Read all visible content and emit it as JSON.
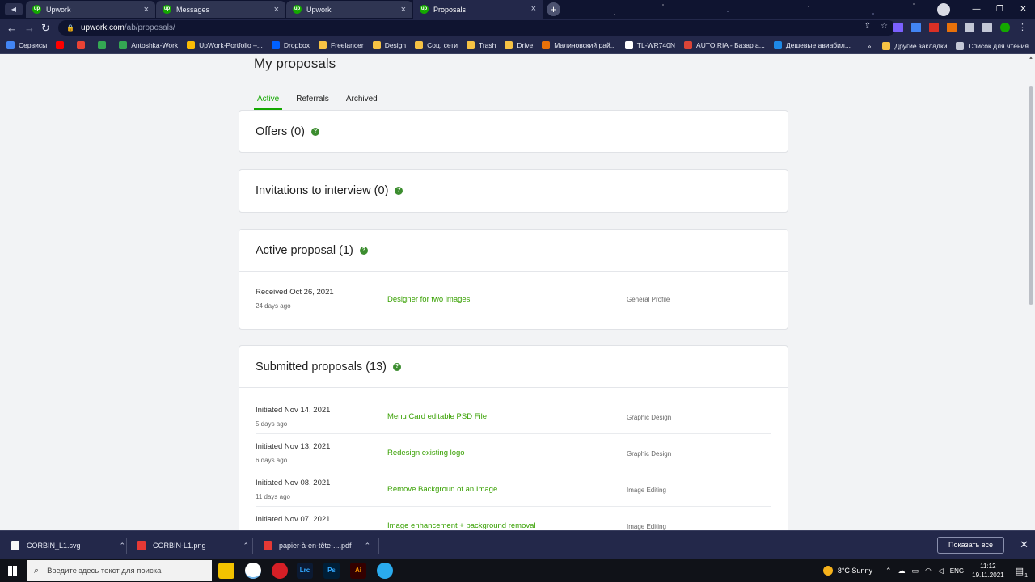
{
  "browser": {
    "tabs": [
      {
        "title": "Upwork",
        "active": false
      },
      {
        "title": "Messages",
        "active": false
      },
      {
        "title": "Upwork",
        "active": false
      },
      {
        "title": "Proposals",
        "active": true
      }
    ],
    "url_host": "upwork.com",
    "url_path": "/ab/proposals/",
    "bookmarks": [
      {
        "label": "Сервисы",
        "color": "#4285f4"
      },
      {
        "label": "",
        "color": "#ff0000"
      },
      {
        "label": "",
        "color": "#ea4335"
      },
      {
        "label": "",
        "color": "#34a853"
      },
      {
        "label": "Antoshka-Work",
        "color": "#34a853"
      },
      {
        "label": "UpWork-Portfolio –...",
        "color": "#fbbc04"
      },
      {
        "label": "Dropbox",
        "color": "#0061ff"
      },
      {
        "label": "Freelancer",
        "color": "#f6c244"
      },
      {
        "label": "Design",
        "color": "#f6c244"
      },
      {
        "label": "Соц. сети",
        "color": "#f6c244"
      },
      {
        "label": "Trash",
        "color": "#f6c244"
      },
      {
        "label": "Drive",
        "color": "#f6c244"
      },
      {
        "label": "Малиновский рай...",
        "color": "#e8710a"
      },
      {
        "label": "TL-WR740N",
        "color": "#ffffff"
      },
      {
        "label": "AUTO.RIA - Базар а...",
        "color": "#db4437"
      },
      {
        "label": "Дешевые авиабил...",
        "color": "#1e88e5"
      }
    ],
    "bookmarks_more": "»",
    "other_bookmarks": "Другие закладки",
    "reading_list": "Список для чтения"
  },
  "page": {
    "title": "My proposals",
    "subtabs": [
      {
        "label": "Active",
        "active": true
      },
      {
        "label": "Referrals",
        "active": false
      },
      {
        "label": "Archived",
        "active": false
      }
    ],
    "sections": {
      "offers": {
        "title": "Offers (0)"
      },
      "invitations": {
        "title": "Invitations to interview (0)"
      },
      "active": {
        "title": "Active proposal (1)",
        "rows": [
          {
            "date": "Received Oct 26, 2021",
            "ago": "24 days ago",
            "job": "Designer for two images",
            "profile": "General Profile"
          }
        ]
      },
      "submitted": {
        "title": "Submitted proposals (13)",
        "rows": [
          {
            "date": "Initiated Nov 14, 2021",
            "ago": "5 days ago",
            "job": "Menu Card editable PSD File",
            "profile": "Graphic Design"
          },
          {
            "date": "Initiated Nov 13, 2021",
            "ago": "6 days ago",
            "job": "Redesign existing logo",
            "profile": "Graphic Design"
          },
          {
            "date": "Initiated Nov 08, 2021",
            "ago": "11 days ago",
            "job": "Remove Backgroun of an Image",
            "profile": "Image Editing"
          },
          {
            "date": "Initiated Nov 07, 2021",
            "ago": "",
            "job": "Image enhancement + background removal",
            "profile": "Image Editing"
          }
        ]
      }
    }
  },
  "downloads": {
    "items": [
      {
        "name": "CORBIN_L1.svg",
        "color": "#f5f5f5"
      },
      {
        "name": "CORBIN-L1.png",
        "color": "#e53935"
      },
      {
        "name": "papier-à-en-tête-....pdf",
        "color": "#e53935"
      }
    ],
    "show_all": "Показать все"
  },
  "taskbar": {
    "search_placeholder": "Введите здесь текст для поиска",
    "apps": [
      {
        "label": "",
        "color": "#f2c200",
        "text_color": "#000"
      },
      {
        "label": "",
        "color": "#ffffff",
        "text_color": "#000"
      },
      {
        "label": "",
        "color": "#d61f26",
        "text_color": "#fff"
      },
      {
        "label": "Lrc",
        "color": "#0b1a33",
        "text_color": "#31a8ff"
      },
      {
        "label": "Ps",
        "color": "#001e36",
        "text_color": "#31a8ff"
      },
      {
        "label": "Ai",
        "color": "#330000",
        "text_color": "#ff9a00"
      },
      {
        "label": "",
        "color": "#2aabee",
        "text_color": "#fff"
      }
    ],
    "weather": "8°C  Sunny",
    "lang": "ENG",
    "time": "11:12",
    "date": "19.11.2021",
    "notifications": "1"
  }
}
